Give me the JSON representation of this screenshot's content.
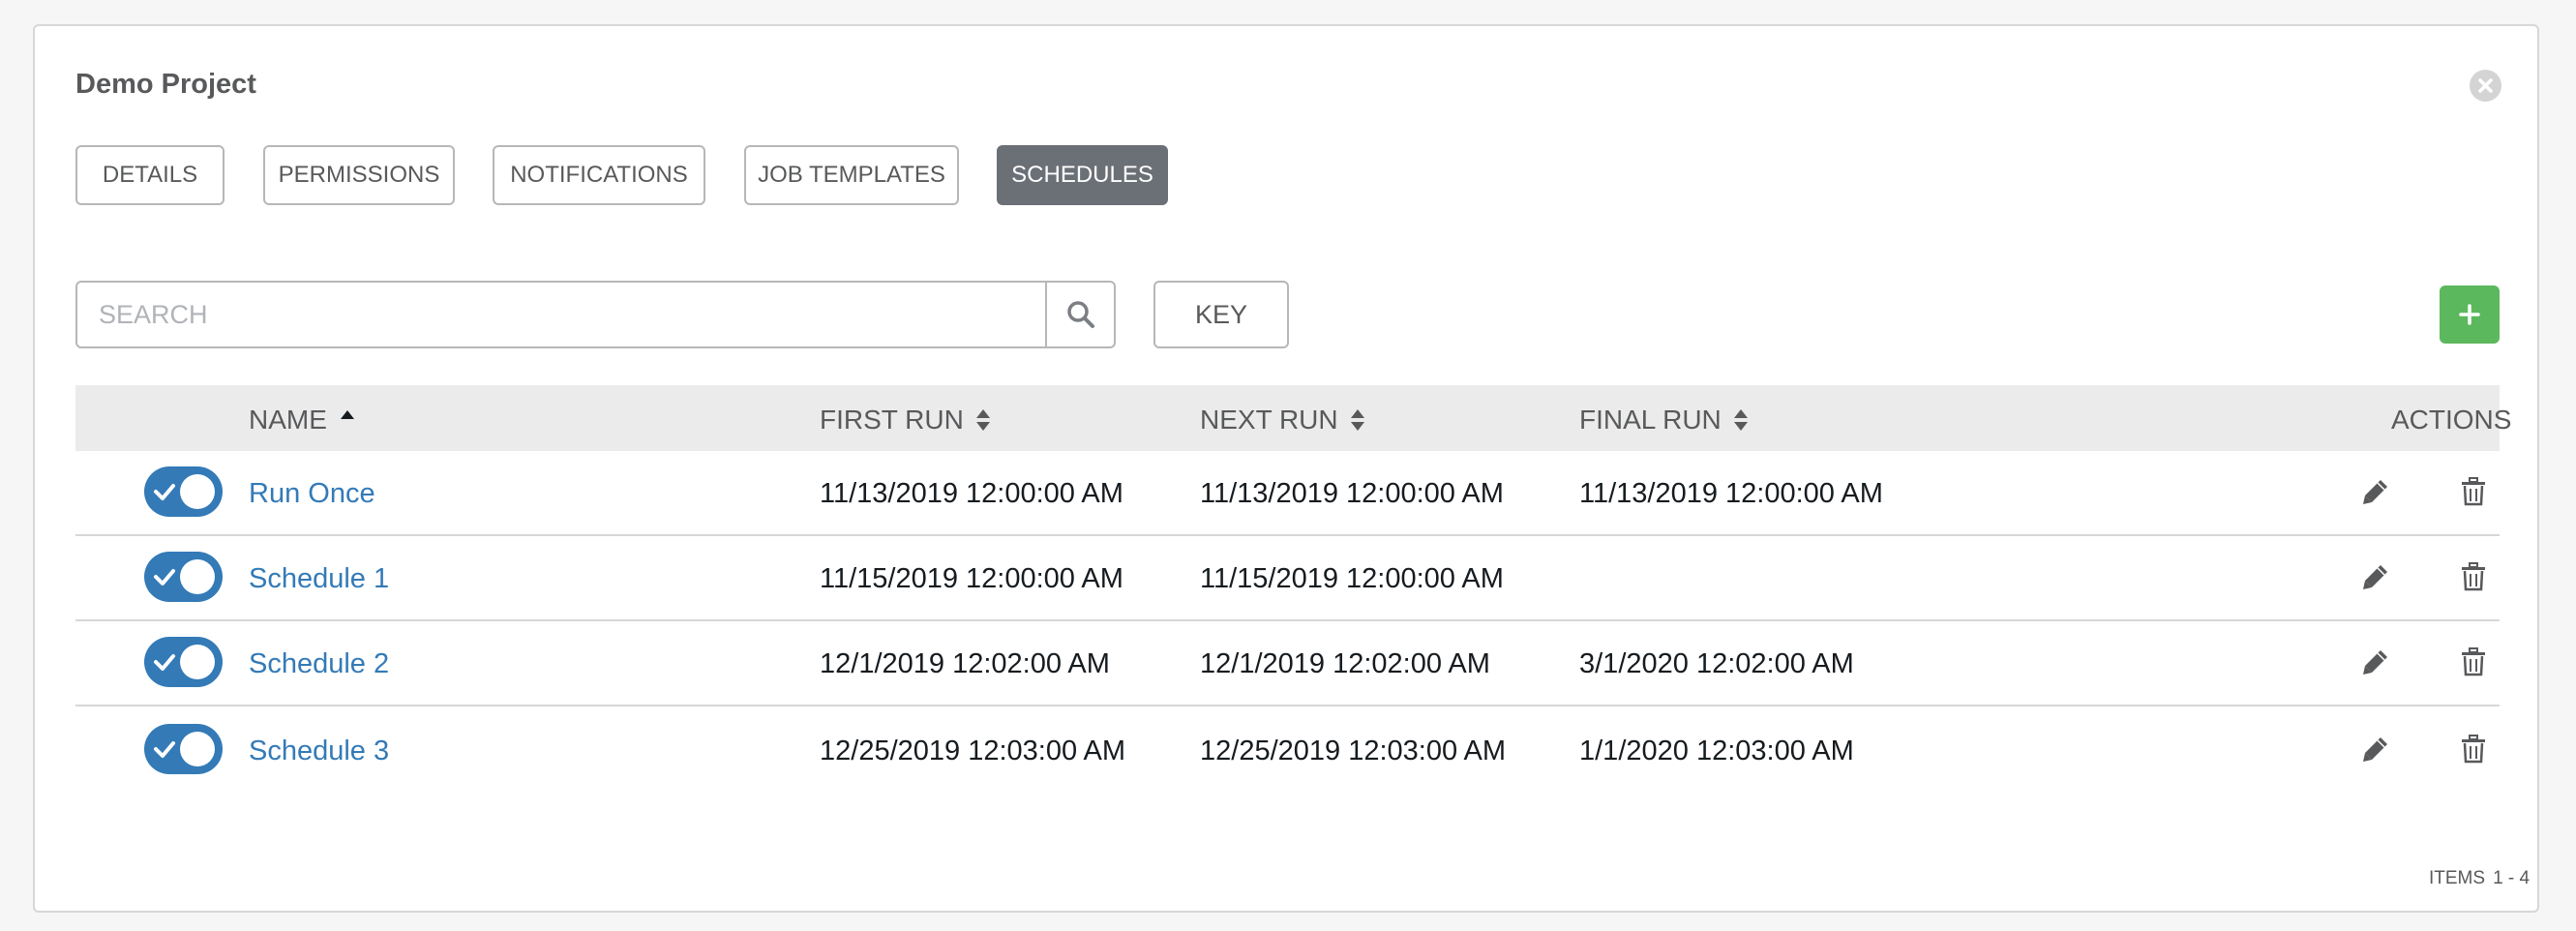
{
  "panel": {
    "title": "Demo Project"
  },
  "tabs": [
    {
      "label": "DETAILS",
      "active": false
    },
    {
      "label": "PERMISSIONS",
      "active": false
    },
    {
      "label": "NOTIFICATIONS",
      "active": false
    },
    {
      "label": "JOB TEMPLATES",
      "active": false
    },
    {
      "label": "SCHEDULES",
      "active": true
    }
  ],
  "toolbar": {
    "search_placeholder": "SEARCH",
    "search_value": "",
    "key_label": "KEY",
    "add_label": "+"
  },
  "table": {
    "columns": {
      "name": "NAME",
      "first_run": "FIRST RUN",
      "next_run": "NEXT RUN",
      "final_run": "FINAL RUN",
      "actions": "ACTIONS"
    },
    "sort": {
      "column": "name",
      "direction": "ascending"
    },
    "rows": [
      {
        "enabled": true,
        "name": "Run Once",
        "first_run": "11/13/2019 12:00:00 AM",
        "next_run": "11/13/2019 12:00:00 AM",
        "final_run": "11/13/2019 12:00:00 AM"
      },
      {
        "enabled": true,
        "name": "Schedule 1",
        "first_run": "11/15/2019 12:00:00 AM",
        "next_run": "11/15/2019 12:00:00 AM",
        "final_run": ""
      },
      {
        "enabled": true,
        "name": "Schedule 2",
        "first_run": "12/1/2019 12:02:00 AM",
        "next_run": "12/1/2019 12:02:00 AM",
        "final_run": "3/1/2020 12:02:00 AM"
      },
      {
        "enabled": true,
        "name": "Schedule 3",
        "first_run": "12/25/2019 12:03:00 AM",
        "next_run": "12/25/2019 12:03:00 AM",
        "final_run": "1/1/2020 12:03:00 AM"
      }
    ]
  },
  "pagination": {
    "label": "ITEMS",
    "range": "1 - 4"
  },
  "colors": {
    "toggle_on": "#337ab7",
    "link": "#337ab7",
    "add_button": "#5cb85c",
    "active_tab": "#6b6f76"
  },
  "icons": {
    "close": "close-icon",
    "search": "search-icon",
    "add": "plus-icon",
    "sort_asc": "sort-up-icon",
    "sort": "sort-icon",
    "edit": "pencil-icon",
    "delete": "trash-icon",
    "toggle_check": "check-icon"
  }
}
